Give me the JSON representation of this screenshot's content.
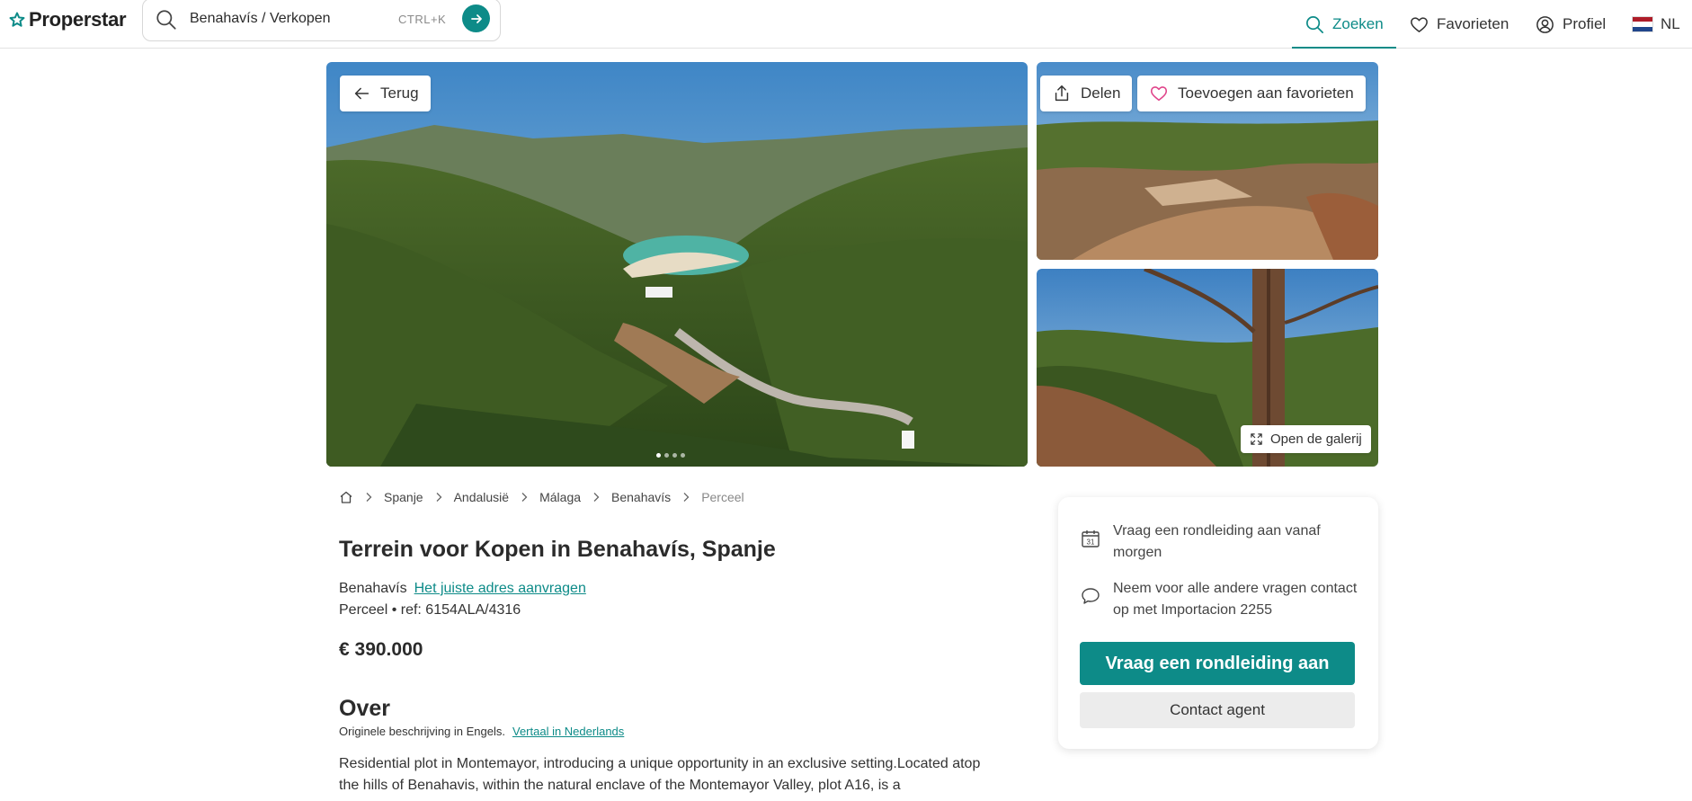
{
  "header": {
    "logo": "Properstar",
    "search": {
      "value": "Benahavís / Verkopen",
      "shortcut": "CTRL+K"
    },
    "nav": [
      {
        "label": "Zoeken",
        "icon": "search-icon",
        "active": true
      },
      {
        "label": "Favorieten",
        "icon": "heart-icon"
      },
      {
        "label": "Profiel",
        "icon": "user-circle-icon"
      },
      {
        "label": "NL",
        "icon": "netherlands-flag-icon"
      }
    ],
    "accent_color": "#0d8b88"
  },
  "gallery": {
    "back_label": "Terug",
    "share_label": "Delen",
    "favorite_label": "Toevoegen aan favorieten",
    "open_gallery_label": "Open de galerij",
    "dot_count": 4,
    "active_dot": 0
  },
  "breadcrumb": {
    "items": [
      "Spanje",
      "Andalusië",
      "Málaga",
      "Benahavís"
    ],
    "current": "Perceel"
  },
  "listing": {
    "title": "Terrein voor Kopen in Benahavís, Spanje",
    "location": "Benahavís",
    "address_link": "Het juiste adres aanvragen",
    "type_ref": "Perceel • ref: 6154ALA/4316",
    "price": "€ 390.000"
  },
  "about": {
    "title": "Over",
    "original_note": "Originele beschrijving in Engels.",
    "translate_link": "Vertaal in Nederlands",
    "description": "Residential plot in Montemayor, introducing a unique opportunity in an exclusive setting.Located atop the hills of Benahavis, within the natural enclave of the Montemayor Valley, plot A16, is a"
  },
  "contact_card": {
    "tour_text": "Vraag een rondleiding aan vanaf morgen",
    "calendar_day": "31",
    "contact_text": "Neem voor alle andere vragen contact op met Importacion 2255",
    "primary_button": "Vraag een rondleiding aan",
    "secondary_button": "Contact agent"
  }
}
